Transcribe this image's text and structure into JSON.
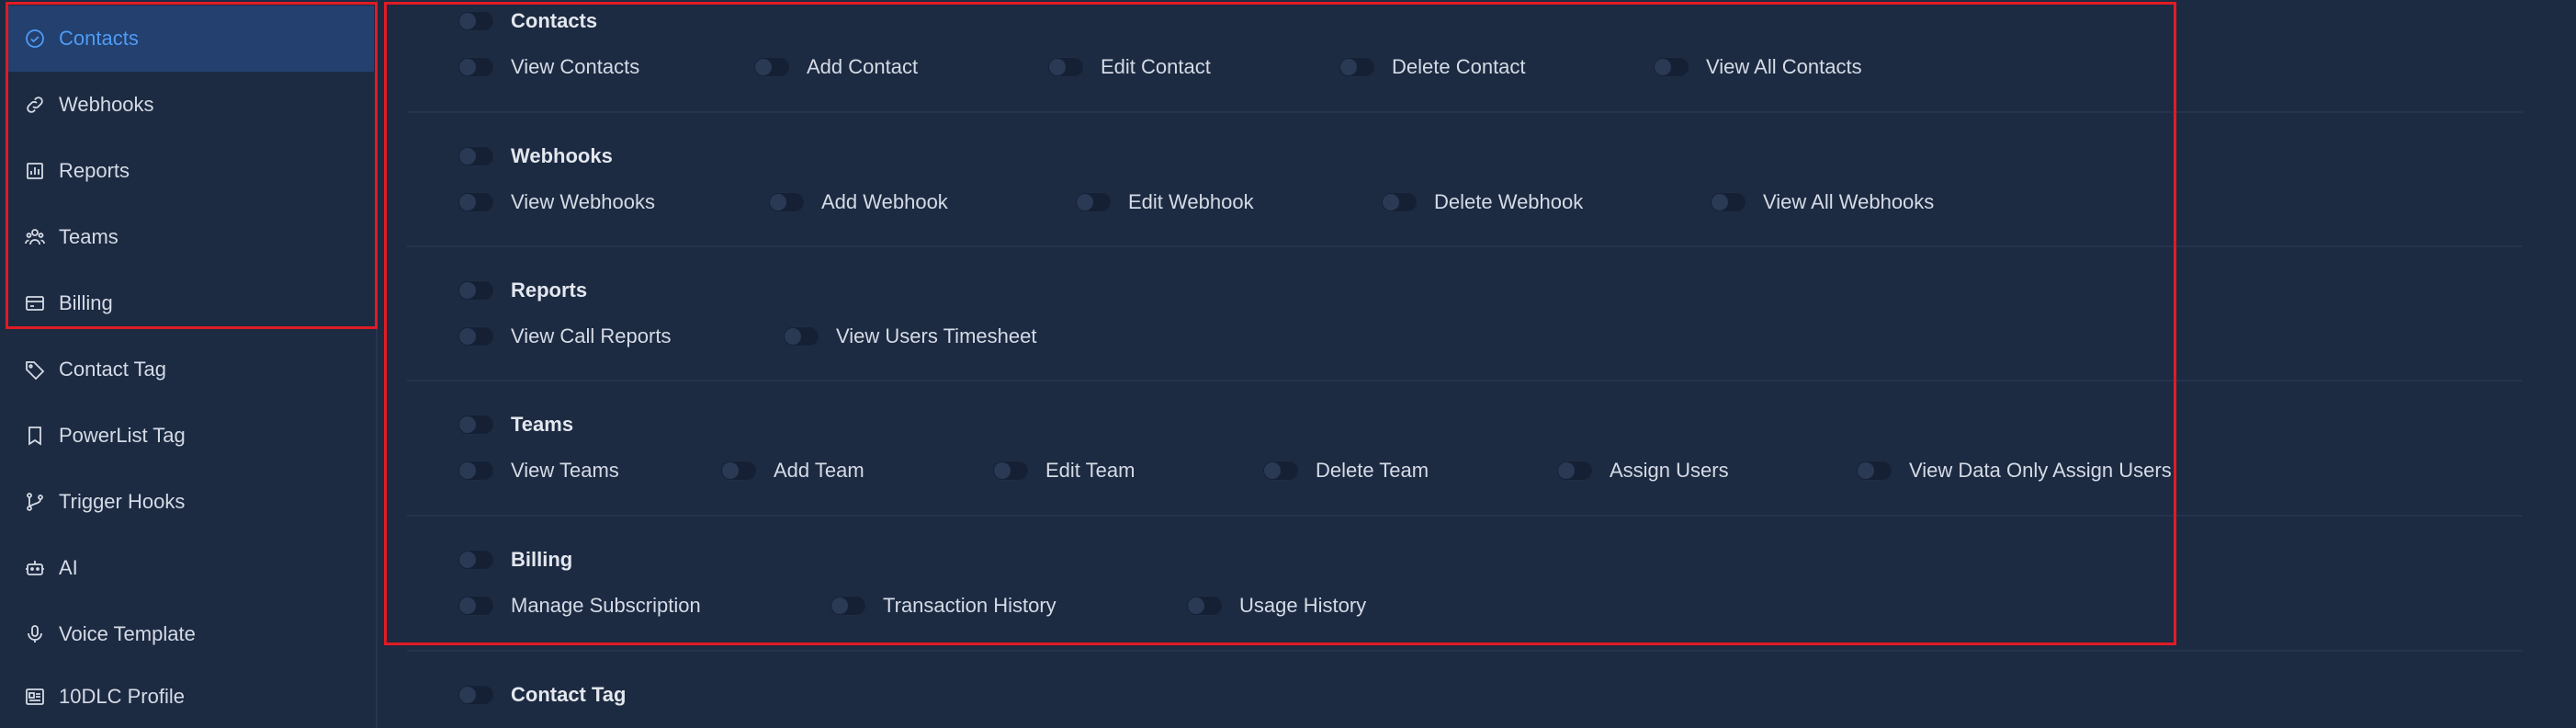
{
  "sidebar": {
    "items": [
      {
        "label": "Contacts",
        "icon": "check-circle-icon",
        "active": true
      },
      {
        "label": "Webhooks",
        "icon": "link-icon"
      },
      {
        "label": "Reports",
        "icon": "bar-chart-icon"
      },
      {
        "label": "Teams",
        "icon": "users-icon"
      },
      {
        "label": "Billing",
        "icon": "card-icon"
      },
      {
        "label": "Contact Tag",
        "icon": "tag-icon"
      },
      {
        "label": "PowerList Tag",
        "icon": "bookmark-icon"
      },
      {
        "label": "Trigger Hooks",
        "icon": "branch-icon"
      },
      {
        "label": "AI",
        "icon": "robot-icon"
      },
      {
        "label": "Voice Template",
        "icon": "microphone-icon"
      },
      {
        "label": "10DLC Profile",
        "icon": "profile-card-icon"
      }
    ]
  },
  "sections": [
    {
      "title": "Contacts",
      "permissions": [
        "View Contacts",
        "Add Contact",
        "Edit Contact",
        "Delete Contact",
        "View All Contacts"
      ]
    },
    {
      "title": "Webhooks",
      "permissions": [
        "View Webhooks",
        "Add Webhook",
        "Edit Webhook",
        "Delete Webhook",
        "View All Webhooks"
      ]
    },
    {
      "title": "Reports",
      "permissions": [
        "View Call Reports",
        "View Users Timesheet"
      ]
    },
    {
      "title": "Teams",
      "permissions": [
        "View Teams",
        "Add Team",
        "Edit Team",
        "Delete Team",
        "Assign Users",
        "View Data Only Assign Users"
      ]
    },
    {
      "title": "Billing",
      "permissions": [
        "Manage Subscription",
        "Transaction History",
        "Usage History"
      ]
    },
    {
      "title": "Contact Tag",
      "permissions": []
    }
  ],
  "colors": {
    "background": "#1c2a42",
    "active_item_bg": "#23406e",
    "active_item_text": "#4f9bf5",
    "highlight_border": "#e01b24"
  }
}
